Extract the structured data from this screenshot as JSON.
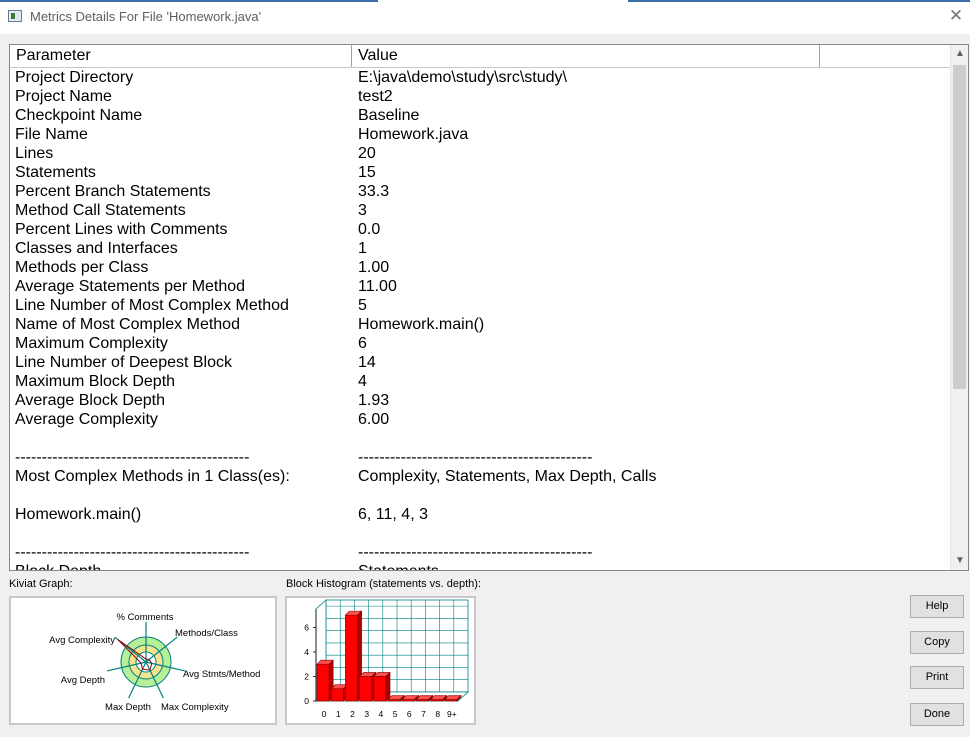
{
  "window": {
    "title": "Metrics Details For File 'Homework.java'",
    "close_glyph": "✕"
  },
  "table": {
    "headers": [
      "Parameter",
      "Value"
    ],
    "rows": [
      [
        "Project Directory",
        "E:\\java\\demo\\study\\src\\study\\"
      ],
      [
        "Project Name",
        "test2"
      ],
      [
        "Checkpoint Name",
        "Baseline"
      ],
      [
        "File Name",
        "Homework.java"
      ],
      [
        "Lines",
        "20"
      ],
      [
        "Statements",
        "15"
      ],
      [
        "Percent Branch Statements",
        "33.3"
      ],
      [
        "Method Call Statements",
        "3"
      ],
      [
        "Percent Lines with Comments",
        "0.0"
      ],
      [
        "Classes and Interfaces",
        "1"
      ],
      [
        "Methods per Class",
        "1.00"
      ],
      [
        "Average Statements per Method",
        "11.00"
      ],
      [
        "Line Number of Most Complex Method",
        "5"
      ],
      [
        "Name of Most Complex Method",
        "Homework.main()"
      ],
      [
        "Maximum Complexity",
        "6"
      ],
      [
        "Line Number of Deepest Block",
        "14"
      ],
      [
        "Maximum Block Depth",
        "4"
      ],
      [
        "Average Block Depth",
        "1.93"
      ],
      [
        "Average Complexity",
        "6.00"
      ],
      [
        "",
        ""
      ],
      [
        "--------------------------------------------",
        "--------------------------------------------"
      ],
      [
        "Most Complex Methods in 1 Class(es):",
        "Complexity, Statements, Max Depth, Calls"
      ],
      [
        "",
        ""
      ],
      [
        "Homework.main()",
        "6, 11, 4, 3"
      ],
      [
        "",
        ""
      ],
      [
        "--------------------------------------------",
        "--------------------------------------------"
      ],
      [
        "Block Depth",
        "Statements"
      ]
    ]
  },
  "kiviat": {
    "label": "Kiviat Graph:",
    "axes": [
      "% Comments",
      "Methods/Class",
      "Avg Stmts/Method",
      "Max Complexity",
      "Max Depth",
      "Avg Depth",
      "Avg Complexity"
    ]
  },
  "histogram": {
    "label": "Block Histogram (statements vs. depth):",
    "y_ticks": [
      "0",
      "2",
      "4",
      "6"
    ],
    "categories": [
      "0",
      "1",
      "2",
      "3",
      "4",
      "5",
      "6",
      "7",
      "8",
      "9+"
    ],
    "values": [
      3,
      1,
      7,
      2,
      2,
      0,
      0,
      0,
      0,
      0
    ],
    "ylim": [
      0,
      7.5
    ],
    "bar_color": "#ff0000"
  },
  "buttons": {
    "help": "Help",
    "copy": "Copy",
    "print": "Print",
    "done": "Done"
  },
  "colors": {
    "kiviat_fill": "#b8f098",
    "kiviat_axes": "#008080",
    "grid": "#008080"
  }
}
